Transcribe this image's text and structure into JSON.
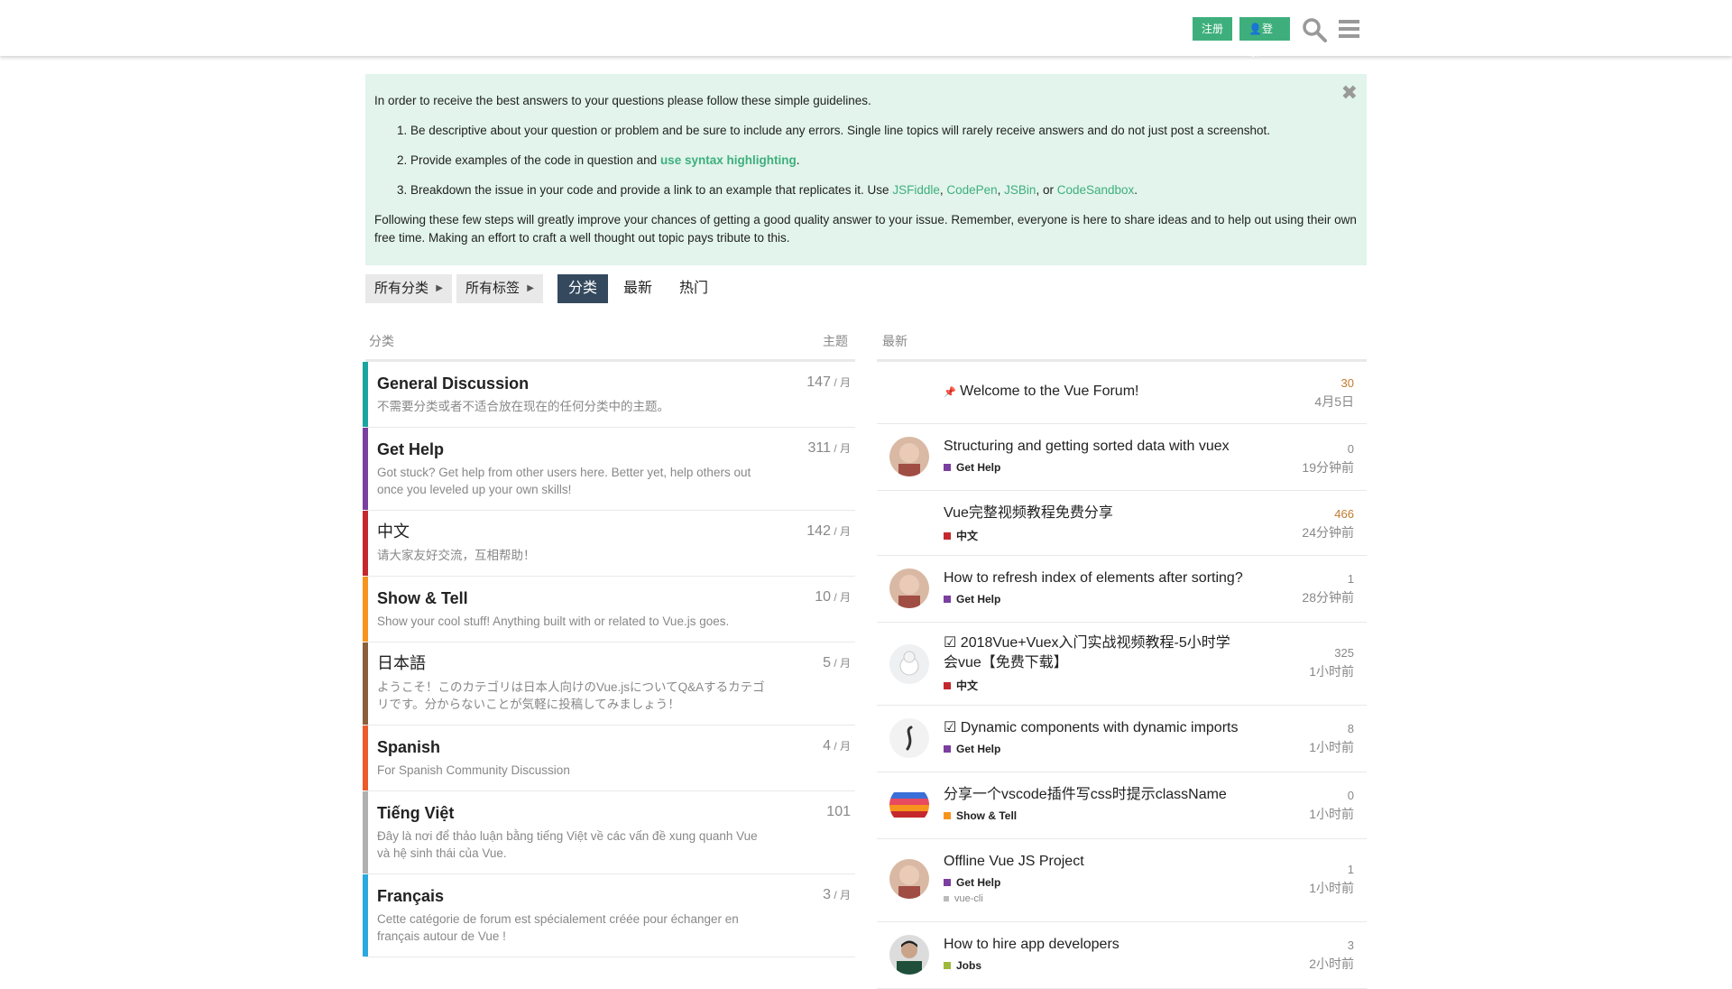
{
  "header": {
    "register": "注册",
    "login": "登录",
    "icons": [
      "search-icon",
      "hamburger-menu-icon"
    ]
  },
  "banner": {
    "intro": "In order to receive the best answers to your questions please follow these simple guidelines.",
    "item1": "Be descriptive about your question or problem and be sure to include any errors. Single line topics will rarely receive answers and do not just post a screenshot.",
    "item2_pre": "Provide examples of the code in question and ",
    "item2_link": "use syntax highlighting",
    "item2_post": ".",
    "item3_pre": "Breakdown the issue in your code and provide a link to an example that replicates it. Use ",
    "link_jsfiddle": "JSFiddle",
    "link_codepen": "CodePen",
    "link_jsbin": "JSBin",
    "or": ", or ",
    "comma": ", ",
    "link_codesandbox": "CodeSandbox",
    "period": ".",
    "outro": "Following these few steps will greatly improve your chances of getting a good quality answer to your issue. Remember, everyone is here to share ideas and to help out using their own free time. Making an effort to craft a well thought out topic pays tribute to this.",
    "close": "✖"
  },
  "nav": {
    "all_categories": "所有分类",
    "all_tags": "所有标签",
    "tabs": [
      "分类",
      "最新",
      "热门"
    ]
  },
  "columns": {
    "category": "分类",
    "topics": "主题",
    "latest": "最新"
  },
  "categories": [
    {
      "name": "General Discussion",
      "desc": "不需要分类或者不适合放在现在的任何分类中的主题。",
      "count": "147",
      "per": " / 月",
      "color": "#1aa5a0"
    },
    {
      "name": "Get Help",
      "desc": "Got stuck? Get help from other users here. Better yet, help others out once you leveled up your own skills!",
      "count": "311",
      "per": " / 月",
      "color": "#7b3fa0"
    },
    {
      "name": "中文",
      "desc": "请大家友好交流，互相帮助！",
      "count": "142",
      "per": " / 月",
      "color": "#c4282d"
    },
    {
      "name": "Show & Tell",
      "desc": "Show your cool stuff! Anything built with or related to Vue.js goes.",
      "count": "10",
      "per": " / 月",
      "color": "#f7941d"
    },
    {
      "name": "日本語",
      "desc": "ようこそ！このカテゴリは日本人向けのVue.jsについてQ&Aするカテゴリです。分からないことが気軽に投稿してみましょう！",
      "count": "5",
      "per": " / 月",
      "color": "#8b5e3c"
    },
    {
      "name": "Spanish",
      "desc": "For Spanish Community Discussion",
      "count": "4",
      "per": " / 月",
      "color": "#ed5b2b"
    },
    {
      "name": "Tiếng Việt",
      "desc": "Đây là nơi để thảo luận bằng tiếng Việt về các vấn đề xung quanh Vue và hệ sinh thái của Vue.",
      "count": "101",
      "per": "",
      "color": "#b0b0b0"
    },
    {
      "name": "Français",
      "desc": "Cette catégorie de forum est spécialement créée pour échanger en français autour de Vue !",
      "count": "3",
      "per": " / 月",
      "color": "#29a9e0"
    }
  ],
  "topics": [
    {
      "title": "Welcome to the Vue Forum!",
      "pinned": "📌",
      "replies": "30",
      "time": "4月5日"
    },
    {
      "title": "Structuring and getting sorted data with vuex",
      "category": "Get Help",
      "cat_color": "#7b3fa0",
      "replies": "0",
      "time": "19分钟前"
    },
    {
      "title": "Vue完整视频教程免费分享",
      "category": "中文",
      "cat_color": "#c4282d",
      "replies": "466",
      "time": "24分钟前"
    },
    {
      "title": "How to refresh index of elements after sorting?",
      "category": "Get Help",
      "cat_color": "#7b3fa0",
      "replies": "1",
      "time": "28分钟前"
    },
    {
      "title": "2018Vue+Vuex入门实战视频教程-5小时学会vue【免费下载】",
      "category": "中文",
      "cat_color": "#c4282d",
      "replies": "325",
      "time": "1小时前",
      "solved": "☑"
    },
    {
      "title": "Dynamic components with dynamic imports",
      "category": "Get Help",
      "cat_color": "#7b3fa0",
      "replies": "8",
      "time": "1小时前",
      "solved": "☑"
    },
    {
      "title": "分享一个vscode插件写css时提示className",
      "category": "Show & Tell",
      "cat_color": "#f7941d",
      "replies": "0",
      "time": "1小时前"
    },
    {
      "title": "Offline Vue JS Project",
      "category": "Get Help",
      "cat_color": "#7b3fa0",
      "tag": "vue-cli",
      "replies": "1",
      "time": "1小时前"
    },
    {
      "title": "How to hire app developers",
      "category": "Jobs",
      "cat_color": "#9eb83b",
      "replies": "3",
      "time": "2小时前"
    }
  ]
}
